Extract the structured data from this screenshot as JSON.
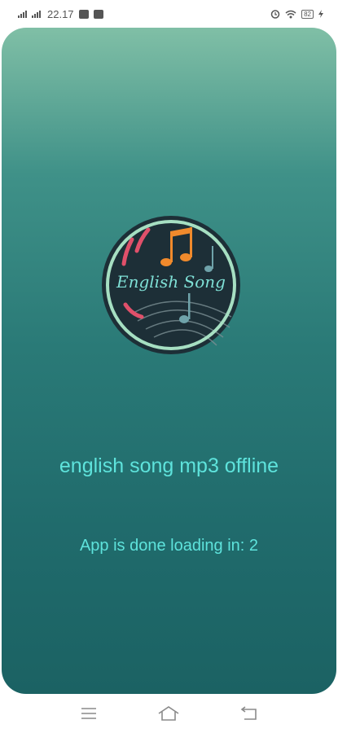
{
  "status_bar": {
    "time": "22.17",
    "battery": "82"
  },
  "splash": {
    "logo_text": "English Song",
    "app_name": "english song mp3 offline",
    "loading_text": "App is done loading in: 2"
  },
  "nav_bar": {
    "icons": [
      "menu-icon",
      "home-icon",
      "back-icon"
    ]
  },
  "colors": {
    "gradient_top": "#80bfa6",
    "gradient_bottom": "#1b6263",
    "text_accent": "#5ee3dc"
  }
}
